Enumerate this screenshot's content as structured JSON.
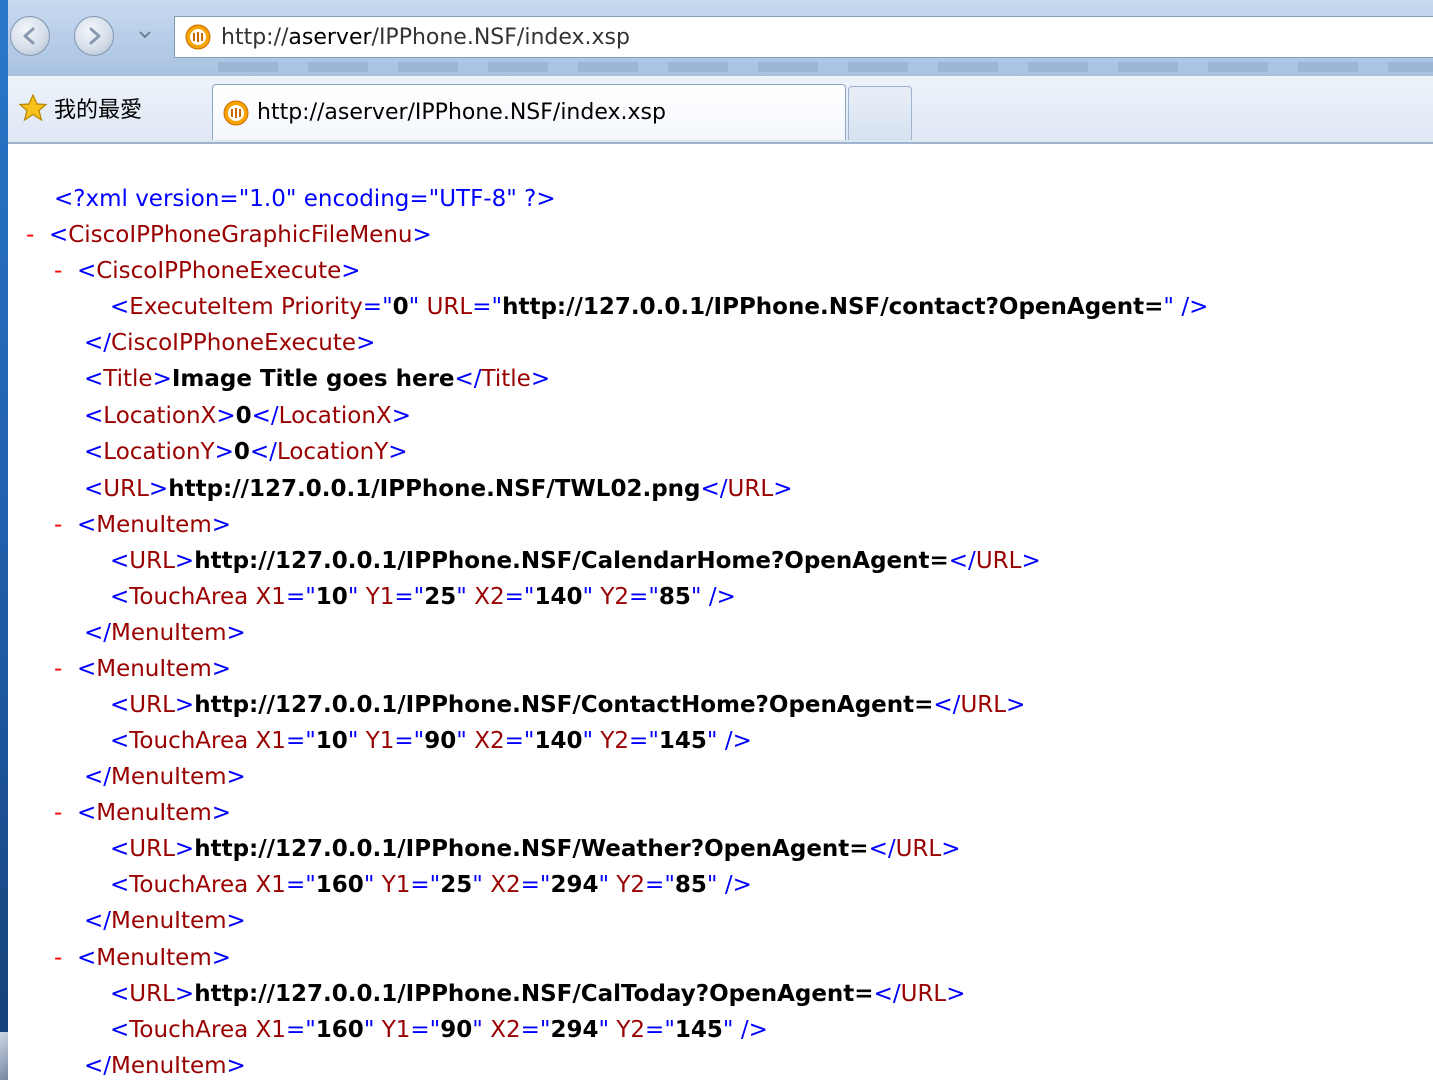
{
  "browser": {
    "address_url_prefix": "http://",
    "address_url_host": "aserver",
    "address_url_path": "/IPPhone.NSF/index.xsp",
    "favorites_label": "我的最愛",
    "tab_title": "http://aserver/IPPhone.NSF/index.xsp"
  },
  "icons": {
    "back": "back-arrow-icon",
    "forward": "forward-arrow-icon",
    "dropdown": "chevron-down-icon",
    "site": "site-favicon-icon",
    "favorites": "star-icon"
  },
  "xml": {
    "declaration": "<?xml version=\"1.0\" encoding=\"UTF-8\" ?>",
    "collapse_symbol": "-",
    "root_tag": "CiscoIPPhoneGraphicFileMenu",
    "execute_tag": "CiscoIPPhoneExecute",
    "execute_item": {
      "tag": "ExecuteItem",
      "priority_attr": "Priority",
      "priority_value": "0",
      "url_attr": "URL",
      "url_value": "http://127.0.0.1/IPPhone.NSF/contact?OpenAgent="
    },
    "title": {
      "tag": "Title",
      "value": "Image Title goes here"
    },
    "location_x": {
      "tag": "LocationX",
      "value": "0"
    },
    "location_y": {
      "tag": "LocationY",
      "value": "0"
    },
    "url": {
      "tag": "URL",
      "value": "http://127.0.0.1/IPPhone.NSF/TWL02.png"
    },
    "menu_item_tag": "MenuItem",
    "url_tag": "URL",
    "touch_tag": "TouchArea",
    "attr_names": {
      "x1": "X1",
      "y1": "Y1",
      "x2": "X2",
      "y2": "Y2"
    },
    "menu_items": [
      {
        "url": "http://127.0.0.1/IPPhone.NSF/CalendarHome?OpenAgent=",
        "x1": "10",
        "y1": "25",
        "x2": "140",
        "y2": "85"
      },
      {
        "url": "http://127.0.0.1/IPPhone.NSF/ContactHome?OpenAgent=",
        "x1": "10",
        "y1": "90",
        "x2": "140",
        "y2": "145"
      },
      {
        "url": "http://127.0.0.1/IPPhone.NSF/Weather?OpenAgent=",
        "x1": "160",
        "y1": "25",
        "x2": "294",
        "y2": "85"
      },
      {
        "url": "http://127.0.0.1/IPPhone.NSF/CalToday?OpenAgent=",
        "x1": "160",
        "y1": "90",
        "x2": "294",
        "y2": "145"
      }
    ]
  }
}
